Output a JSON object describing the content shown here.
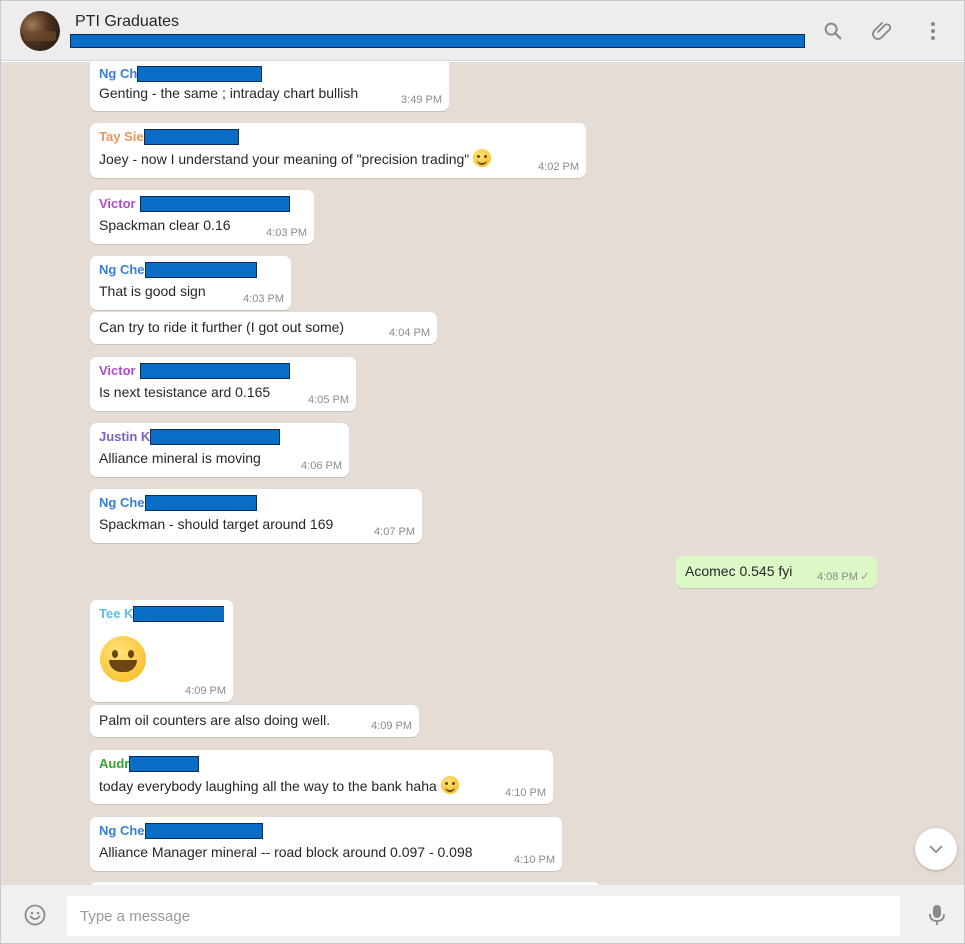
{
  "header": {
    "title": "PTI Graduates"
  },
  "colors": {
    "header_bg": "#ededed",
    "chat_bg": "#e5ddd5",
    "incoming_bubble": "#ffffff",
    "outgoing_bubble": "#dcf8c6",
    "redaction": "#0a6ec7"
  },
  "messages": [
    {
      "sender": "Ng Ch",
      "sender_color": "#3a7fd5",
      "text": "Genting - the same ; intraday chart bullish",
      "time": "3:49 PM"
    },
    {
      "sender": "Tay Sie",
      "sender_color": "#f0935a",
      "text": "Joey - now I understand your meaning of \"precision trading\"",
      "time": "4:02 PM"
    },
    {
      "sender": "Victor",
      "sender_color": "#b04cc8",
      "text": "Spackman clear 0.16",
      "time": "4:03 PM"
    },
    {
      "sender": "Ng Che",
      "sender_color": "#3a7fd5",
      "text": "That is good sign",
      "time": "4:03 PM"
    },
    {
      "sender": "",
      "text": "Can try to ride it further (I got out some)",
      "time": "4:04 PM"
    },
    {
      "sender": "Victor",
      "sender_color": "#b04cc8",
      "text": "Is next tesistance ard 0.165",
      "time": "4:05 PM"
    },
    {
      "sender": "Justin K",
      "sender_color": "#7b62c4",
      "text": "Alliance mineral is moving",
      "time": "4:06 PM"
    },
    {
      "sender": "Ng Che",
      "sender_color": "#3a7fd5",
      "text": "Spackman - should target around 169",
      "time": "4:07 PM"
    },
    {
      "sender": "",
      "text": "Acomec 0.545 fyi",
      "time": "4:08 PM",
      "outgoing": true
    },
    {
      "sender": "Tee K",
      "sender_color": "#5dbde6",
      "text": "",
      "time": "4:09 PM",
      "emoji_only": true
    },
    {
      "sender": "",
      "text": "Palm oil counters are also doing well.",
      "time": "4:09 PM"
    },
    {
      "sender": "Audr",
      "sender_color": "#35a33a",
      "text": "today everybody laughing all the way to the bank haha",
      "time": "4:10 PM"
    },
    {
      "sender": "Ng Che",
      "sender_color": "#3a7fd5",
      "text": "Alliance Manager mineral -- road block around 0.097 - 0.098",
      "time": "4:10 PM"
    }
  ],
  "composer": {
    "placeholder": "Type a message"
  }
}
